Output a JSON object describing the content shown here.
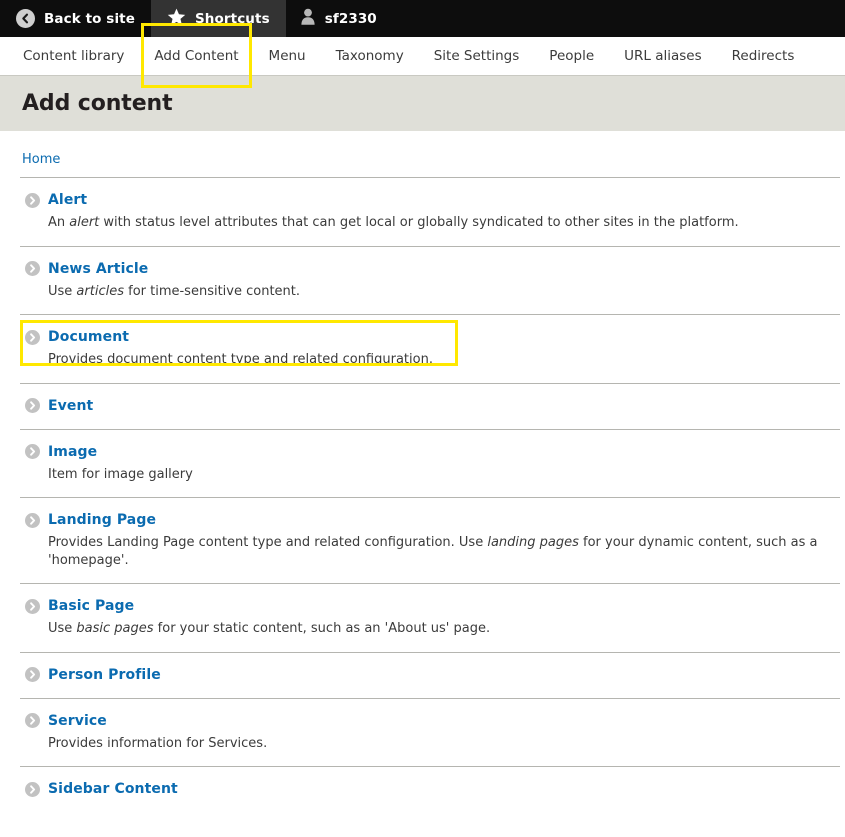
{
  "toolbar": {
    "back_label": "Back to site",
    "back_icon": "chevron-left-circle-icon",
    "shortcuts_label": "Shortcuts",
    "shortcuts_icon": "star-icon",
    "user_label": "sf2330",
    "user_icon": "person-icon"
  },
  "subnav": {
    "items": [
      {
        "label": "Content library",
        "highlighted": false
      },
      {
        "label": "Add Content",
        "highlighted": true
      },
      {
        "label": "Menu",
        "highlighted": false
      },
      {
        "label": "Taxonomy",
        "highlighted": false
      },
      {
        "label": "Site Settings",
        "highlighted": false
      },
      {
        "label": "People",
        "highlighted": false
      },
      {
        "label": "URL aliases",
        "highlighted": false
      },
      {
        "label": "Redirects",
        "highlighted": false
      }
    ]
  },
  "page": {
    "title": "Add content",
    "breadcrumb": "Home"
  },
  "colors": {
    "link_blue": "#0b6bb0",
    "highlight_yellow": "#ffe800",
    "band_gray": "#dfdfd8",
    "toolbar_black": "#0d0d0d",
    "toolbar_active": "#333333"
  },
  "content_types": [
    {
      "name": "Alert",
      "desc_html": "An <em>alert</em> with status level attributes that can get local or globally syndicated to other sites in the platform.",
      "highlighted": false
    },
    {
      "name": "News Article",
      "desc_html": "Use <em>articles</em> for time-sensitive content.",
      "highlighted": false
    },
    {
      "name": "Document",
      "desc_html": "Provides document content type and related configuration.",
      "highlighted": true
    },
    {
      "name": "Event",
      "desc_html": "",
      "highlighted": false
    },
    {
      "name": "Image",
      "desc_html": "Item for image gallery",
      "highlighted": false
    },
    {
      "name": "Landing Page",
      "desc_html": "Provides Landing Page content type and related configuration. Use <em>landing pages</em> for your dynamic content, such as a 'homepage'.",
      "highlighted": false
    },
    {
      "name": "Basic Page",
      "desc_html": "Use <em>basic pages</em> for your static content, such as an 'About us' page.",
      "highlighted": false
    },
    {
      "name": "Person Profile",
      "desc_html": "",
      "highlighted": false
    },
    {
      "name": "Service",
      "desc_html": "Provides information for Services.",
      "highlighted": false
    },
    {
      "name": "Sidebar Content",
      "desc_html": "",
      "highlighted": false
    }
  ]
}
